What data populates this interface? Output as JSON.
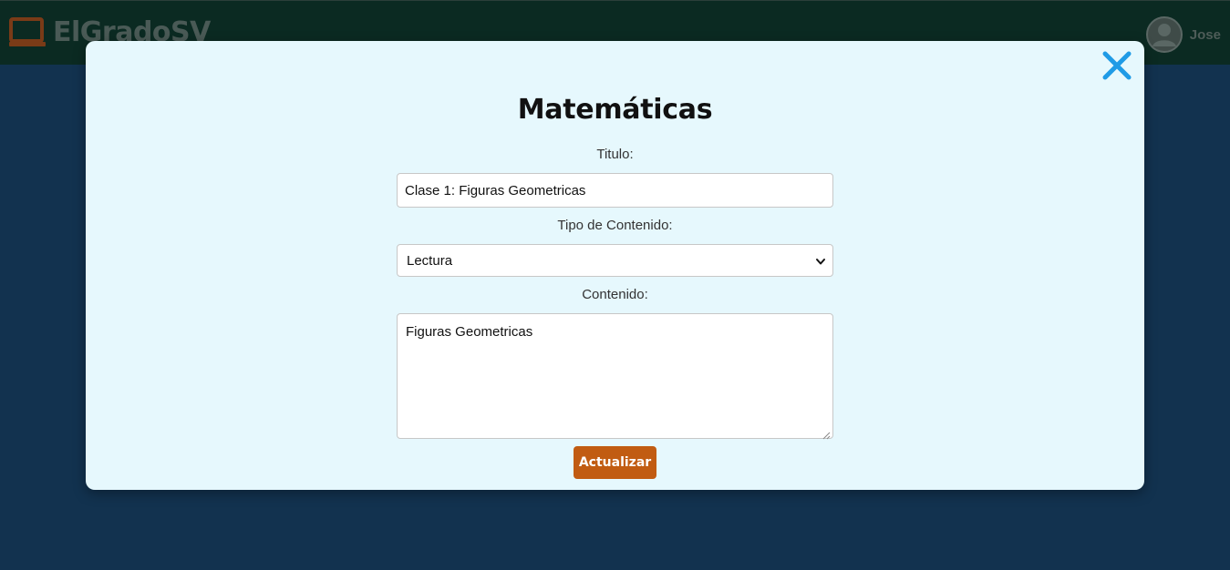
{
  "header": {
    "brand_name": "ElGradoSV",
    "brand_icon": "chalkboard-icon",
    "user_icon": "user-avatar-icon",
    "user_name": "Jose"
  },
  "modal": {
    "close_icon": "close-icon",
    "title": "Matemáticas",
    "titulo_label": "Titulo:",
    "titulo_value": "Clase 1: Figuras Geometricas",
    "tipo_label": "Tipo de Contenido:",
    "tipo_selected": "Lectura",
    "contenido_label": "Contenido:",
    "contenido_value": "Figuras Geometricas",
    "submit_label": "Actualizar"
  },
  "colors": {
    "page_background": "#12324f",
    "navbar_background": "#0b2a22",
    "modal_background": "#e6f8fd",
    "close_icon": "#1f9be6",
    "accent_button": "#c15c12",
    "brand_icon": "#7a3b17"
  }
}
